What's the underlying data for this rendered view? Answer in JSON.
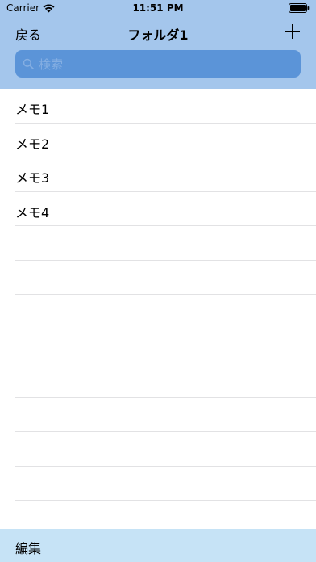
{
  "status_bar": {
    "carrier": "Carrier",
    "time": "11:51 PM",
    "wifi_icon": "wifi-icon",
    "battery_icon": "battery-full-icon"
  },
  "nav": {
    "back_label": "戻る",
    "title": "フォルダ1",
    "add_icon": "plus-icon"
  },
  "search": {
    "placeholder": "検索",
    "icon": "search-icon"
  },
  "memos": [
    {
      "title": "メモ1"
    },
    {
      "title": "メモ2"
    },
    {
      "title": "メモ3"
    },
    {
      "title": "メモ4"
    }
  ],
  "toolbar": {
    "edit_label": "編集"
  },
  "colors": {
    "header_bg": "#a4c6ec",
    "search_bg": "#5b94d8",
    "toolbar_bg": "#c6e3f6",
    "separator": "#e2e2e4"
  }
}
